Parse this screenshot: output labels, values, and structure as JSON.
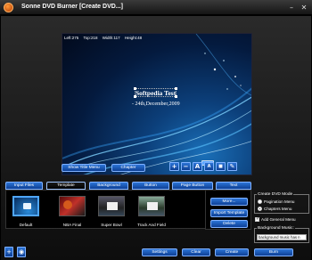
{
  "window": {
    "title": "Sonne DVD Burner [Create DVD...]",
    "minimize": "–",
    "close": "✕"
  },
  "preview": {
    "coords": {
      "left": "Left:275",
      "top": "Top:218",
      "width": "Width:117",
      "height": "Height:48"
    },
    "title_text": "Softpedia Test",
    "date_text": "- 24th,December,2009"
  },
  "preview_buttons": {
    "show_title_menu": "Show Title Menu",
    "chapter": "Chapter"
  },
  "text_tools": {
    "add": "+",
    "remove": "−",
    "font_bigger": "A",
    "font_smaller": "A",
    "color": "■",
    "edit": "✎"
  },
  "tabs": [
    {
      "label": "Input Files"
    },
    {
      "label": "Template"
    },
    {
      "label": "Background"
    },
    {
      "label": "Button"
    },
    {
      "label": "Page Button"
    },
    {
      "label": "Text"
    }
  ],
  "templates": [
    {
      "label": "Default"
    },
    {
      "label": "NBA Final"
    },
    {
      "label": "Super Bowl"
    },
    {
      "label": "Track And Field"
    }
  ],
  "side_buttons": {
    "more": "More...",
    "import": "Import Template",
    "delete": "Delete"
  },
  "dvd_mode": {
    "label": "Create DVD Mode",
    "options": [
      "Pagination Menu",
      "Chapters Menu"
    ],
    "selected": "Chapters Menu",
    "add_general_menu": "Add General Menu"
  },
  "background_music": {
    "label": "Background Music:",
    "value": "background music has n"
  },
  "bottom_buttons": {
    "settings": "Settings",
    "clear": "Clear",
    "create": "Create",
    "burn": "Burn"
  },
  "bottom_icons": [
    "disc-add-icon",
    "disc-icon"
  ],
  "colors": {
    "button_blue": "#0d3f95",
    "button_border": "#7fb1ff",
    "preview_glow": "#1a6fb8"
  }
}
